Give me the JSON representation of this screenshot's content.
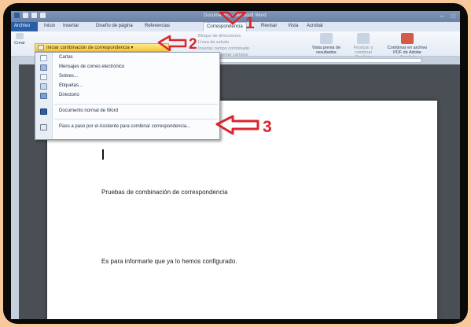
{
  "window": {
    "title": "Documento1 - Microsoft Word"
  },
  "tabs": [
    {
      "label": "Archivo"
    },
    {
      "label": "Inicio"
    },
    {
      "label": "Insertar"
    },
    {
      "label": "Diseño de página"
    },
    {
      "label": "Referencias"
    },
    {
      "label": "Correspondencia"
    },
    {
      "label": "Revisar"
    },
    {
      "label": "Vista"
    },
    {
      "label": "Acrobat"
    }
  ],
  "ribbon": {
    "crear_label": "Crear",
    "merge_button_label": "Iniciar combinación de correspondencia",
    "bloque_direcciones": "Bloque de direcciones",
    "linea_saludo": "Línea de saludo",
    "insertar_campo_combinado": "Insertar campo combinado",
    "insertar_campos_group": "Insertar campos",
    "vista_previa": "Vista previa de resultados",
    "finalizar_y_combinar": "Finalizar y combinar",
    "finalizar_group": "Finalizar",
    "combinar_pdf": "Combinar en archivo PDF de Adobe",
    "acrobat_group": "Acrobat"
  },
  "dropdown": {
    "items": [
      {
        "label": "Cartas",
        "icon": "letter-icon"
      },
      {
        "label": "Mensajes de correo electrónico",
        "icon": "email-icon"
      },
      {
        "label": "Sobres...",
        "icon": "envelope-icon"
      },
      {
        "label": "Etiquetas...",
        "icon": "labels-icon"
      },
      {
        "label": "Directorio",
        "icon": "directory-icon"
      },
      {
        "label": "Documento normal de Word",
        "icon": "word-doc-icon"
      },
      {
        "label": "Paso a paso por el Asistente para combinar correspondencia...",
        "icon": "wizard-icon"
      }
    ]
  },
  "document": {
    "line1": "Pruebas de combinación de correspondencia",
    "line2": "Es para informarle que ya lo hemos configurado."
  },
  "annotations": {
    "n1": "1",
    "n2": "2",
    "n3": "3",
    "color": "#d8262c"
  }
}
